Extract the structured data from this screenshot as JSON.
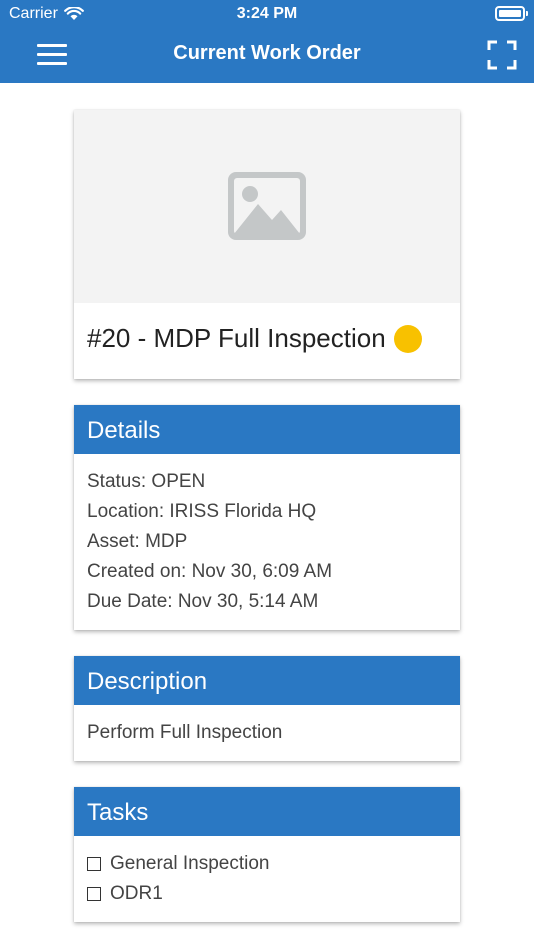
{
  "status_bar": {
    "carrier": "Carrier",
    "time": "3:24 PM"
  },
  "nav": {
    "title": "Current Work Order"
  },
  "icons": {
    "menu": "hamburger-menu-icon",
    "scan": "scan-frame-icon",
    "image": "image-placeholder-icon",
    "wifi": "wifi-icon",
    "battery": "battery-icon"
  },
  "work_order": {
    "title": "#20 - MDP Full Inspection",
    "priority_color": "#f8c100"
  },
  "details": {
    "header": "Details",
    "status": "Status: OPEN",
    "location": "Location: IRISS Florida HQ",
    "asset": "Asset: MDP",
    "created": "Created on: Nov 30, 6:09 AM",
    "due": "Due Date: Nov 30, 5:14 AM"
  },
  "description": {
    "header": "Description",
    "text": "Perform Full Inspection"
  },
  "tasks": {
    "header": "Tasks",
    "items": [
      "General Inspection",
      "ODR1"
    ]
  },
  "colors": {
    "brand": "#2a78c3",
    "priority": "#f8c100"
  }
}
